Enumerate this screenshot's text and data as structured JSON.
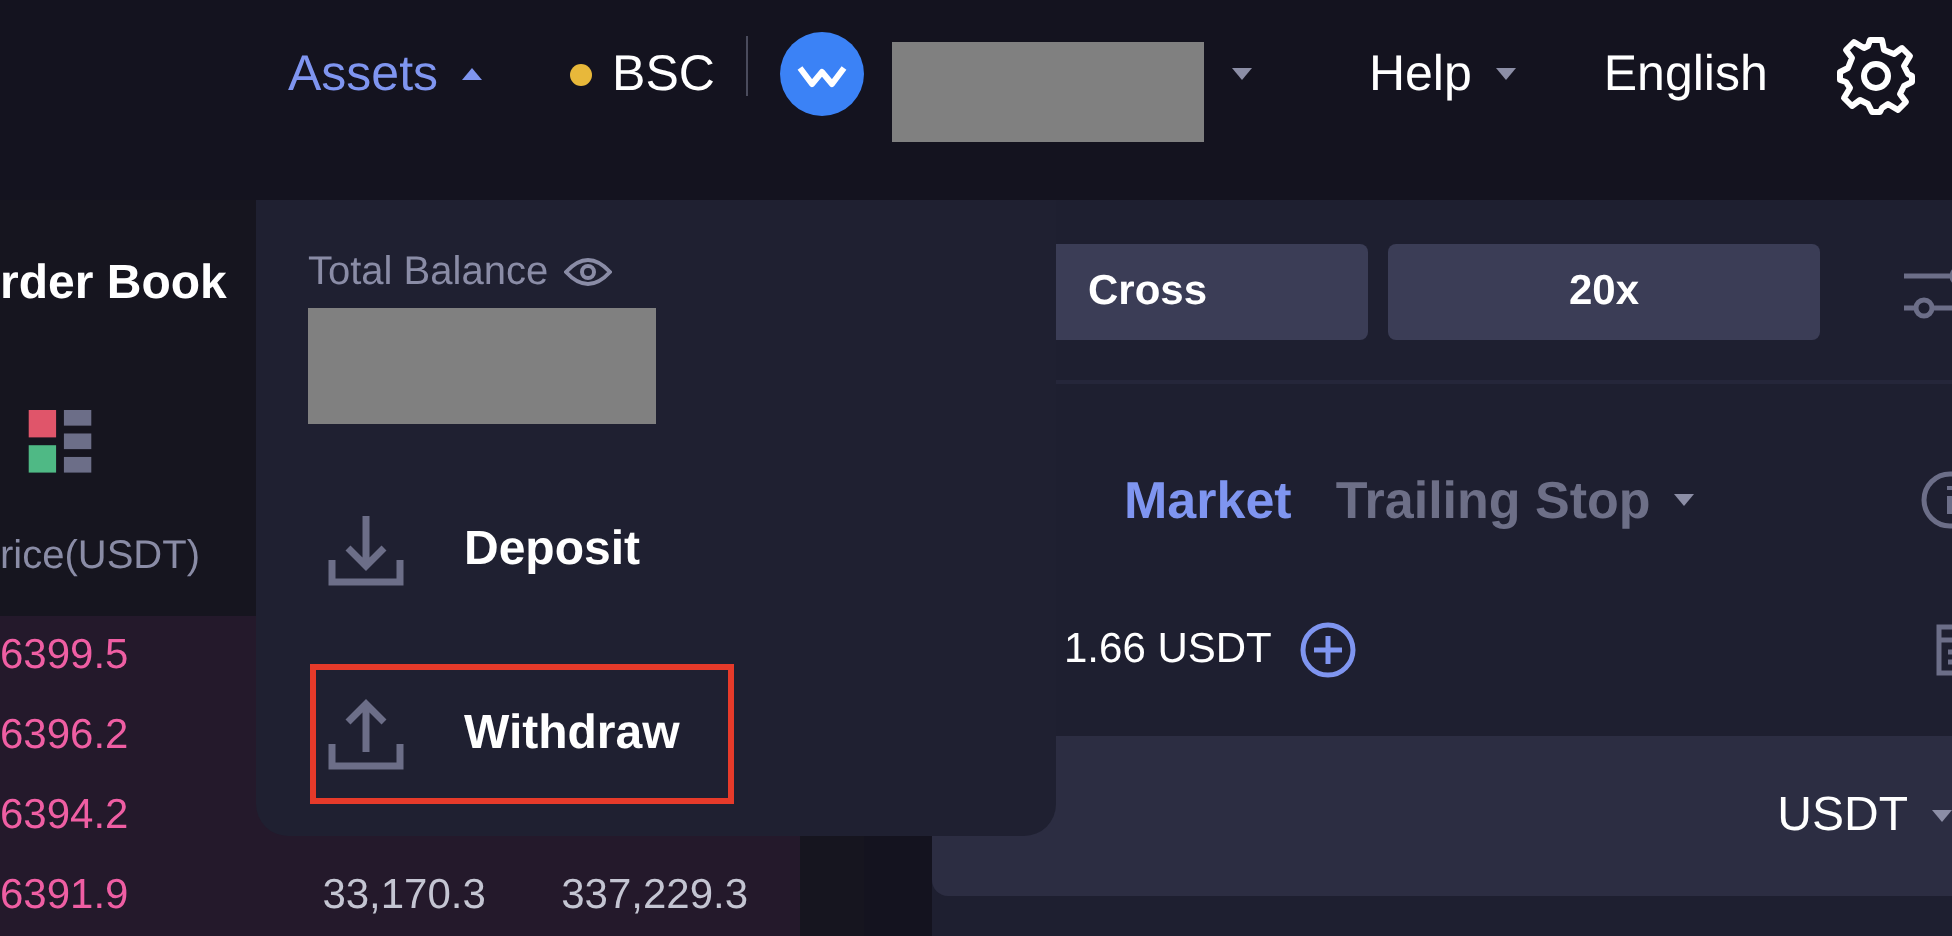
{
  "nav": {
    "items": [
      {
        "kind": "menu",
        "label": "Assets",
        "expanded": true
      },
      {
        "kind": "network",
        "label": "BSC",
        "color": "#e8b83a"
      },
      {
        "kind": "wallet"
      },
      {
        "kind": "menu",
        "label": "Help",
        "expanded": false
      },
      {
        "kind": "link",
        "label": "English"
      }
    ]
  },
  "order_book": {
    "title": "rder Book",
    "column": "rice(USDT)",
    "rows": [
      {
        "price": "6399.5"
      },
      {
        "price": "6396.2"
      },
      {
        "price": "6394.2"
      },
      {
        "price": "6391.9",
        "amount": "33,170.3",
        "total": "337,229.3"
      }
    ]
  },
  "trade": {
    "margin_mode": "Cross",
    "leverage": "20x",
    "order_types": [
      {
        "label": "Market",
        "selected": true
      },
      {
        "label": "Trailing Stop",
        "selected": false
      }
    ],
    "available": "1.66 USDT",
    "unit": "USDT"
  },
  "assets_menu": {
    "title": "Total Balance",
    "items": [
      {
        "kind": "deposit",
        "label": "Deposit",
        "highlighted": false
      },
      {
        "kind": "withdraw",
        "label": "Withdraw",
        "highlighted": true
      }
    ]
  }
}
